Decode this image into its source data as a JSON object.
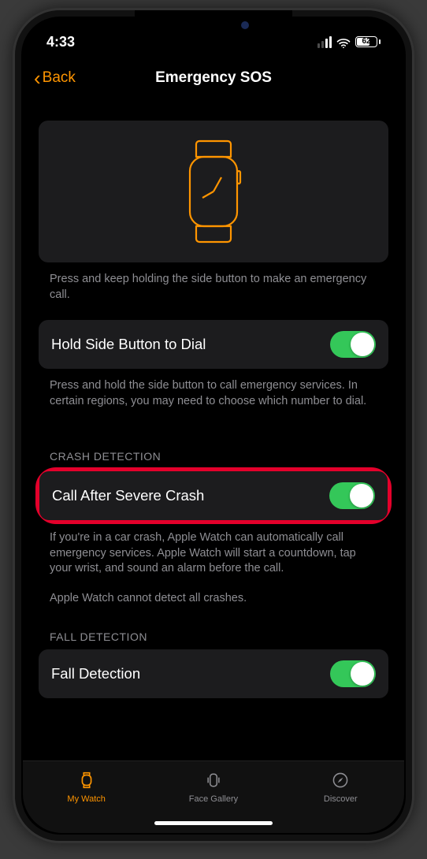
{
  "status": {
    "time": "4:33",
    "battery": "62"
  },
  "nav": {
    "back": "Back",
    "title": "Emergency SOS"
  },
  "hero_desc": "Press and keep holding the side button to make an emergency call.",
  "hold": {
    "label": "Hold Side Button to Dial",
    "desc": "Press and hold the side button to call emergency services. In certain regions, you may need to choose which number to dial."
  },
  "crash": {
    "header": "CRASH DETECTION",
    "label": "Call After Severe Crash",
    "desc": "If you're in a car crash, Apple Watch can automatically call emergency services. Apple Watch will start a countdown, tap your wrist, and sound an alarm before the call.",
    "note": "Apple Watch cannot detect all crashes."
  },
  "fall": {
    "header": "FALL DETECTION",
    "label": "Fall Detection"
  },
  "tabs": {
    "watch": "My Watch",
    "gallery": "Face Gallery",
    "discover": "Discover"
  }
}
